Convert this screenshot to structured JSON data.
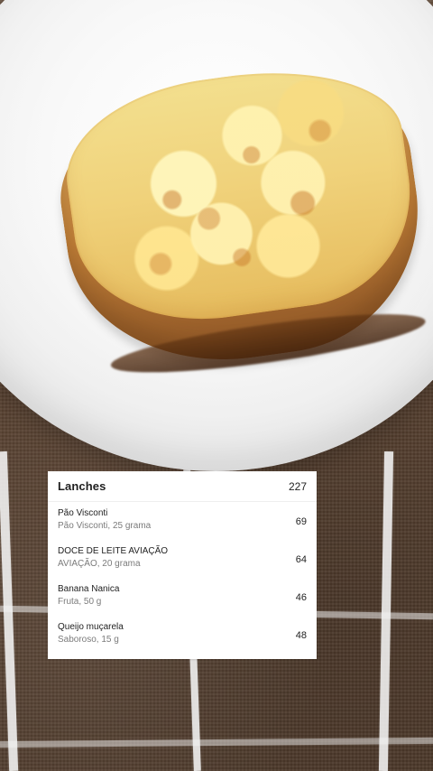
{
  "meal_card": {
    "title": "Lanches",
    "total": "227",
    "items": [
      {
        "name": "Pão Visconti",
        "detail": "Pão Visconti, 25 grama",
        "calories": "69"
      },
      {
        "name": "DOCE DE LEITE AVIAÇÃO",
        "detail": "AVIAÇÃO, 20 grama",
        "calories": "64"
      },
      {
        "name": "Banana Nanica",
        "detail": "Fruta, 50 g",
        "calories": "46"
      },
      {
        "name": "Queijo muçarela",
        "detail": "Saboroso, 15 g",
        "calories": "48"
      }
    ]
  },
  "colors": {
    "card_background": "#ffffff",
    "primary_text": "#222222",
    "secondary_text": "#7b7b7b",
    "plate_white": "#f8f8f8",
    "cloth_brown": "#5a4332",
    "stripe_white": "#f5f5f5"
  }
}
